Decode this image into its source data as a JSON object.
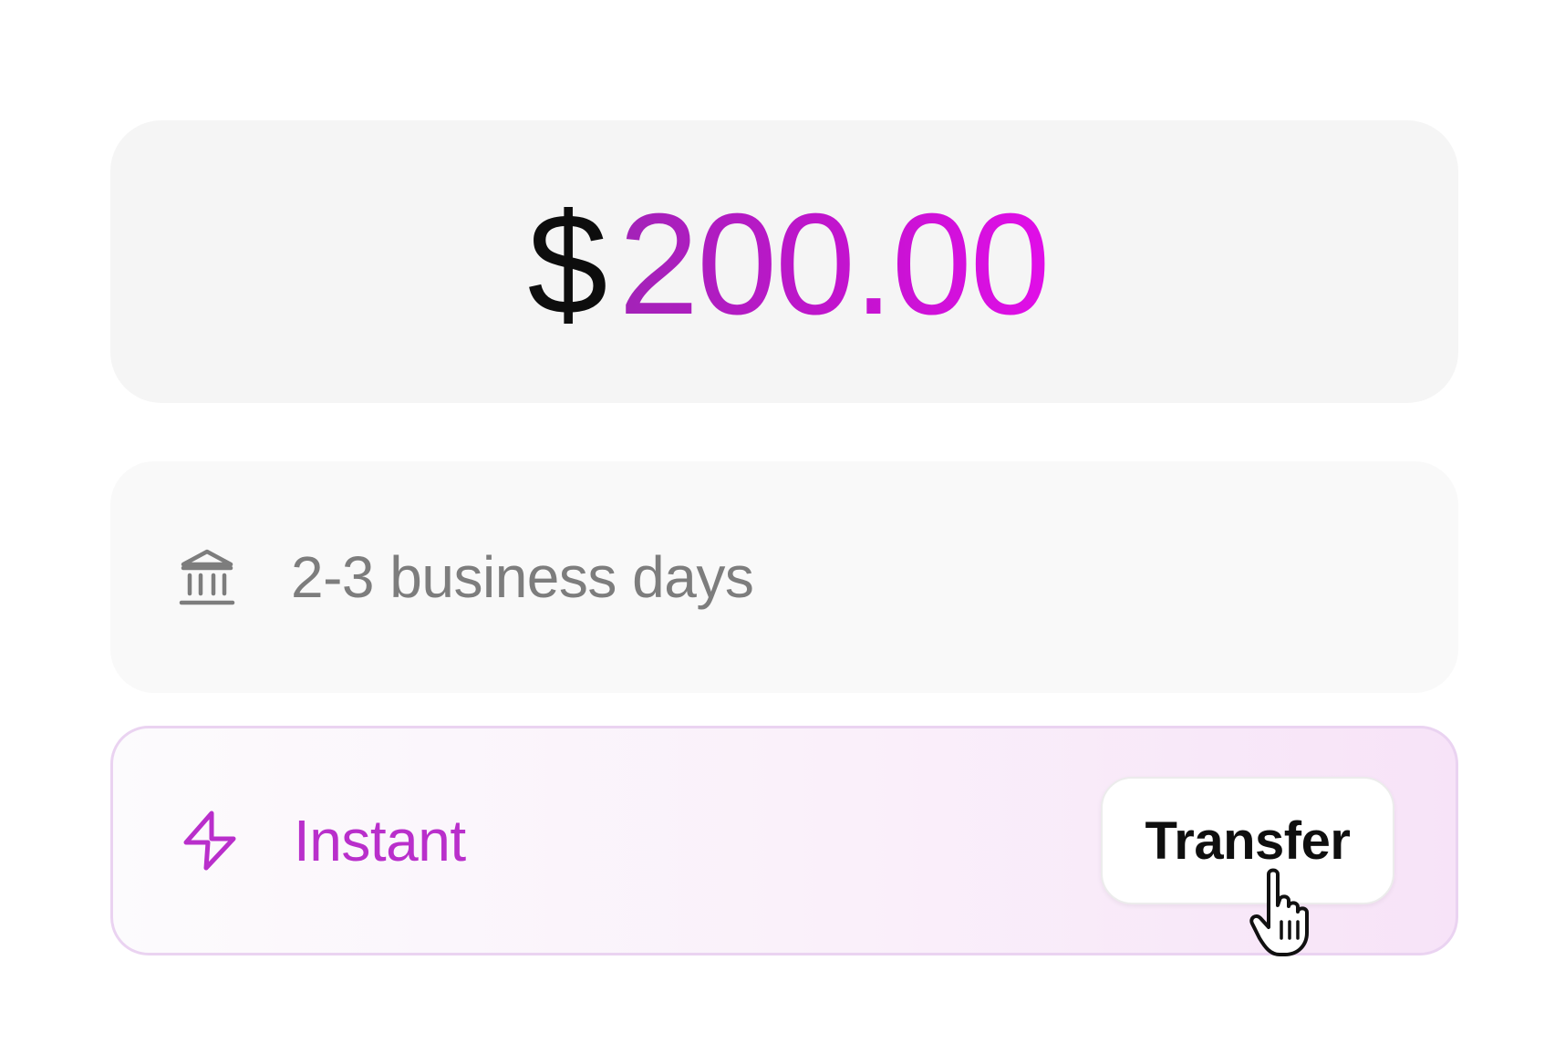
{
  "amount": {
    "currency_symbol": "$",
    "value": "200.00"
  },
  "options": {
    "standard": {
      "icon": "bank-icon",
      "label": "2-3 business days"
    },
    "instant": {
      "icon": "lightning-bolt-icon",
      "label": "Instant",
      "button_label": "Transfer",
      "selected": true
    }
  },
  "cursor": {
    "icon": "hand-pointer-cursor-icon"
  },
  "colors": {
    "amount_gradient_start": "#a223b7",
    "amount_gradient_end": "#e10ee8",
    "instant_accent": "#b92fcb",
    "standard_text": "#7d7d7d",
    "instant_border": "#ead3f1"
  }
}
